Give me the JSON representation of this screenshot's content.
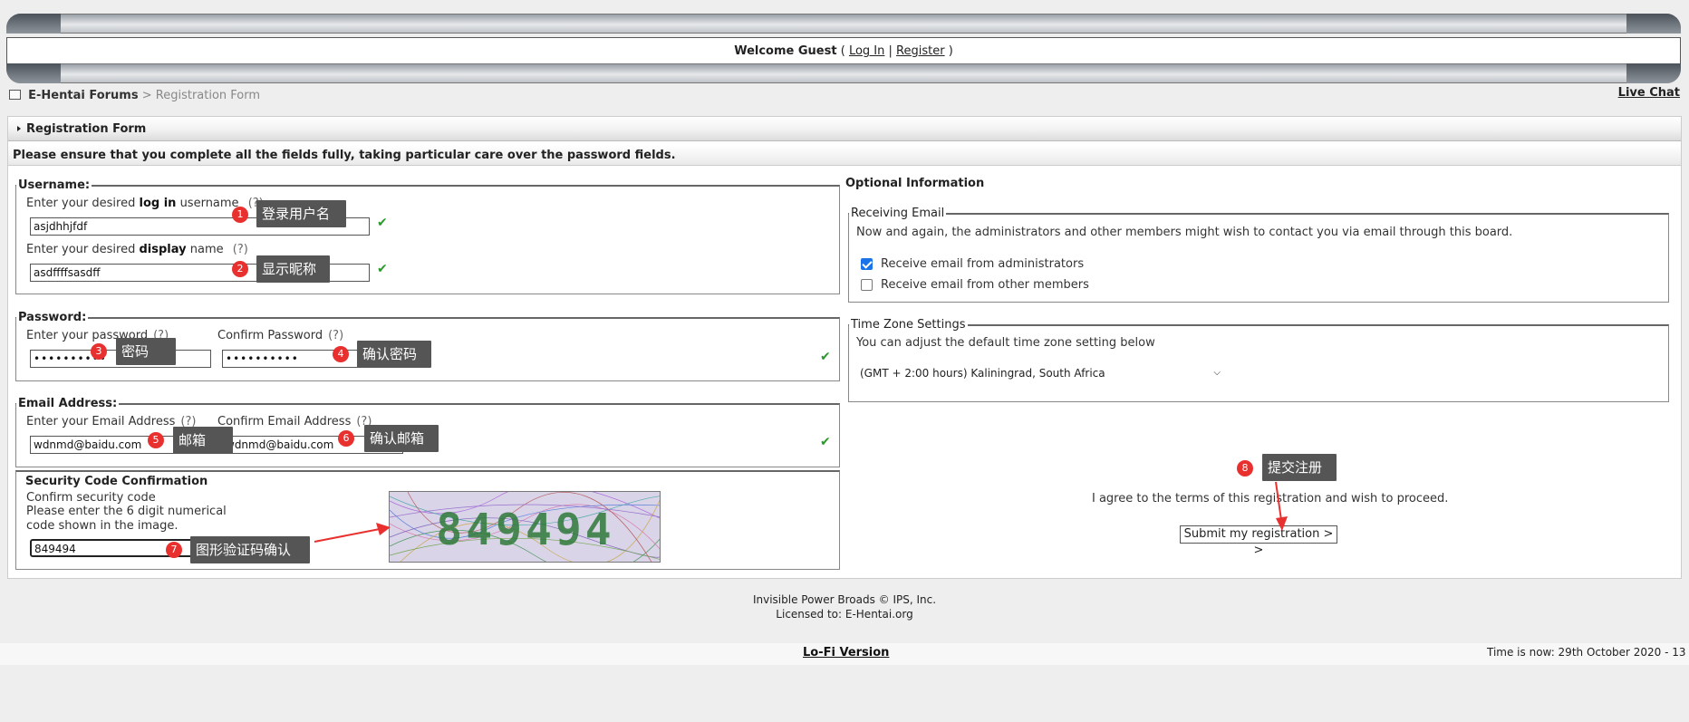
{
  "header": {
    "welcome_prefix": "Welcome Guest",
    "open_paren": "(",
    "login_link": "Log In",
    "separator": "|",
    "register_link": "Register",
    "close_paren": ")"
  },
  "breadcrumb": {
    "home": "E-Hentai Forums",
    "separator": ">",
    "current": "Registration Form"
  },
  "live_chat": "Live Chat",
  "form": {
    "title": "Registration Form",
    "notice": "Please ensure that you complete all the fields fully, taking particular care over the password fields.",
    "username": {
      "legend": "Username:",
      "login_label_pre": "Enter your desired",
      "login_label_bold": "log in",
      "login_label_post": "username",
      "login_value": "asjdhhjfdf",
      "display_label_pre": "Enter your desired",
      "display_label_bold": "display",
      "display_label_post": "name",
      "display_value": "asdffffsasdff",
      "help": "(?)"
    },
    "password": {
      "legend": "Password:",
      "enter_label": "Enter your password",
      "confirm_label": "Confirm Password",
      "enter_value": "••••••••••",
      "confirm_value": "••••••••••",
      "help": "(?)"
    },
    "email": {
      "legend": "Email Address:",
      "enter_label": "Enter your Email Address",
      "confirm_label": "Confirm Email Address",
      "enter_value": "wdnmd@baidu.com",
      "confirm_value": "wdnmd@baidu.com",
      "help": "(?)"
    },
    "security": {
      "legend": "Security Code Confirmation",
      "line1": "Confirm security code",
      "line2": "Please enter the 6 digit numerical",
      "line3": "code shown in the image.",
      "value": "849494",
      "captcha_text": "849494"
    },
    "check_mark": "✔"
  },
  "optional": {
    "title": "Optional Information",
    "receiving_email": {
      "legend": "Receiving Email",
      "description": "Now and again, the administrators and other members might wish to contact you via email through this board.",
      "admin_label": "Receive email from administrators",
      "admin_checked": true,
      "members_label": "Receive email from other members",
      "members_checked": false
    },
    "timezone": {
      "legend": "Time Zone Settings",
      "description": "You can adjust the default time zone setting below",
      "selected": "(GMT + 2:00 hours) Kaliningrad, South Africa"
    },
    "agree_text": "I agree to the terms of this registration and wish to proceed.",
    "submit_label": "Submit my registration > >"
  },
  "annotations": [
    {
      "num": "1",
      "text": "登录用户名"
    },
    {
      "num": "2",
      "text": "显示昵称"
    },
    {
      "num": "3",
      "text": "密码"
    },
    {
      "num": "4",
      "text": "确认密码"
    },
    {
      "num": "5",
      "text": "邮箱"
    },
    {
      "num": "6",
      "text": "确认邮箱"
    },
    {
      "num": "7",
      "text": "图形验证码确认"
    },
    {
      "num": "8",
      "text": "提交注册"
    }
  ],
  "footer": {
    "powered": "Invisible Power Broads © IPS, Inc.",
    "licensed": "Licensed to: E-Hentai.org",
    "lofi": "Lo-Fi Version",
    "time": "Time is now: 29th October 2020 - 13"
  },
  "colors": {
    "check_green": "#2a9a2a",
    "annotation_red": "#e8312f",
    "annotation_box": "#555555"
  }
}
